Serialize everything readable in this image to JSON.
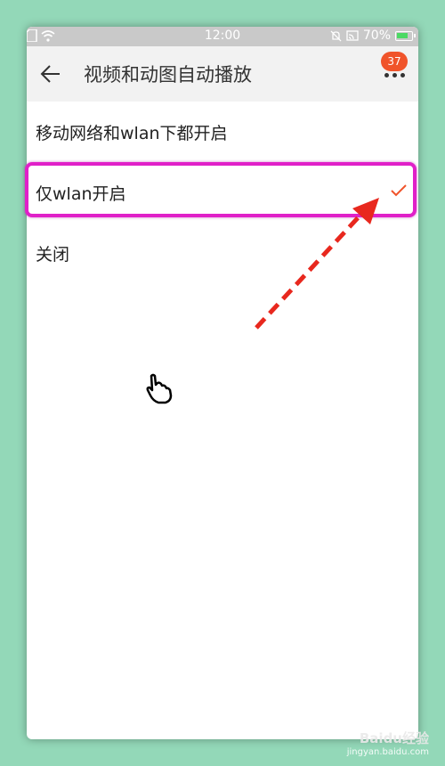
{
  "status_bar": {
    "time": "12:00",
    "battery_percent": "70%"
  },
  "toolbar": {
    "title": "视频和动图自动播放",
    "notification_count": "37"
  },
  "options": [
    {
      "label": "移动网络和wlan下都开启",
      "selected": false
    },
    {
      "label": "仅wlan开启",
      "selected": true
    },
    {
      "label": "关闭",
      "selected": false
    }
  ],
  "colors": {
    "accent": "#f0542b",
    "highlight": "#e020c8",
    "arrow": "#e8281e",
    "background": "#93d8b8"
  },
  "watermark": {
    "main": "Baidu经验",
    "sub": "jingyan.baidu.com"
  }
}
